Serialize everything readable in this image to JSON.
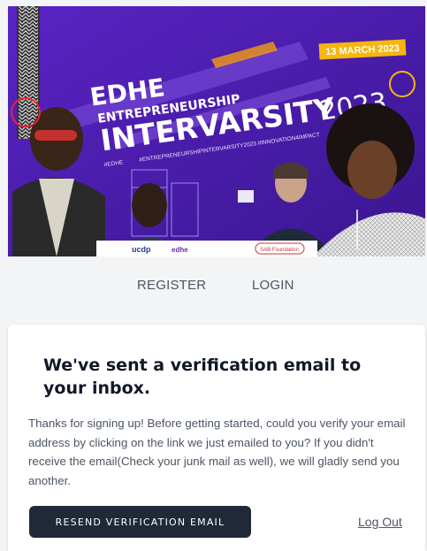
{
  "banner": {
    "date": "13 MARCH 2023",
    "title_line1": "EDHE",
    "title_line2": "ENTREPRENEURSHIP",
    "title_line3": "INTERVARSITY",
    "year": "2023",
    "hashtags": "#ENTREPRENEURSHIPINTERVARSITY2023  #INNOVATION4IMPACT",
    "hashtag_small": "#EDHE",
    "partner_logos": [
      "ucdp",
      "edhe",
      "SAB Foundation"
    ],
    "colors": {
      "bg": "#4b1fa8",
      "accent_yellow": "#f5b60e",
      "accent_orange": "#f39c12"
    }
  },
  "nav": {
    "register": "REGISTER",
    "login": "LOGIN"
  },
  "card": {
    "heading": "We've sent a verification email to your inbox.",
    "body": "Thanks for signing up! Before getting started, could you verify your email address by clicking on the link we just emailed to you? If you didn't receive the email(Check your junk mail as well), we will gladly send you another.",
    "resend_button": "Resend Verification Email",
    "logout_link": "Log Out"
  }
}
